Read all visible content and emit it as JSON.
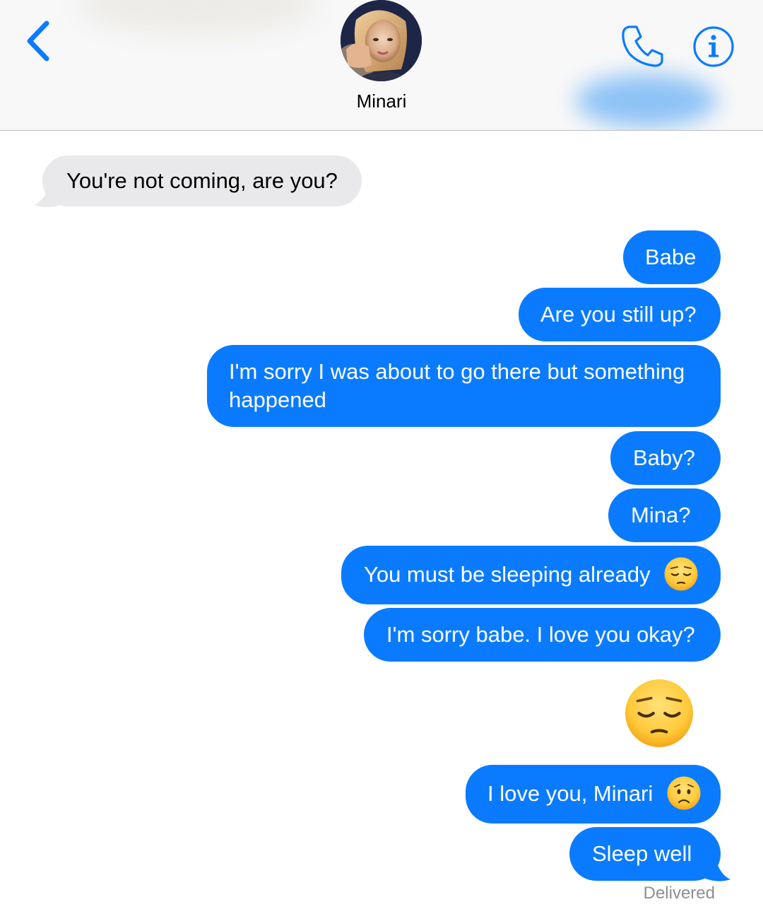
{
  "header": {
    "contact_name": "Minari",
    "back_icon": "chevron-left-icon",
    "call_icon": "phone-icon",
    "info_icon": "info-icon",
    "accent_color": "#0a7bff"
  },
  "messages": {
    "m0": {
      "direction": "incoming",
      "text": "You're not coming, are you?"
    },
    "m1": {
      "direction": "outgoing",
      "text": "Babe"
    },
    "m2": {
      "direction": "outgoing",
      "text": "Are you still up?"
    },
    "m3": {
      "direction": "outgoing",
      "line1": "I'm sorry I was about to go there but something",
      "line2": "happened"
    },
    "m4": {
      "direction": "outgoing",
      "text": "Baby?"
    },
    "m5": {
      "direction": "outgoing",
      "text": "Mina?"
    },
    "m6": {
      "direction": "outgoing",
      "text": "You must be sleeping already",
      "emoji": "pensive-face-emoji"
    },
    "m7": {
      "direction": "outgoing",
      "text": "I'm sorry babe. I love you okay?"
    },
    "m8": {
      "direction": "outgoing",
      "emoji": "pensive-face-emoji"
    },
    "m9": {
      "direction": "outgoing",
      "text": "I love you, Minari",
      "emoji": "worried-face-emoji"
    },
    "m10": {
      "direction": "outgoing",
      "text": "Sleep well"
    }
  },
  "status": "Delivered",
  "colors": {
    "outgoing_bubble": "#0a7bff",
    "incoming_bubble": "#e9e9eb",
    "status_text": "#8e8e93"
  }
}
